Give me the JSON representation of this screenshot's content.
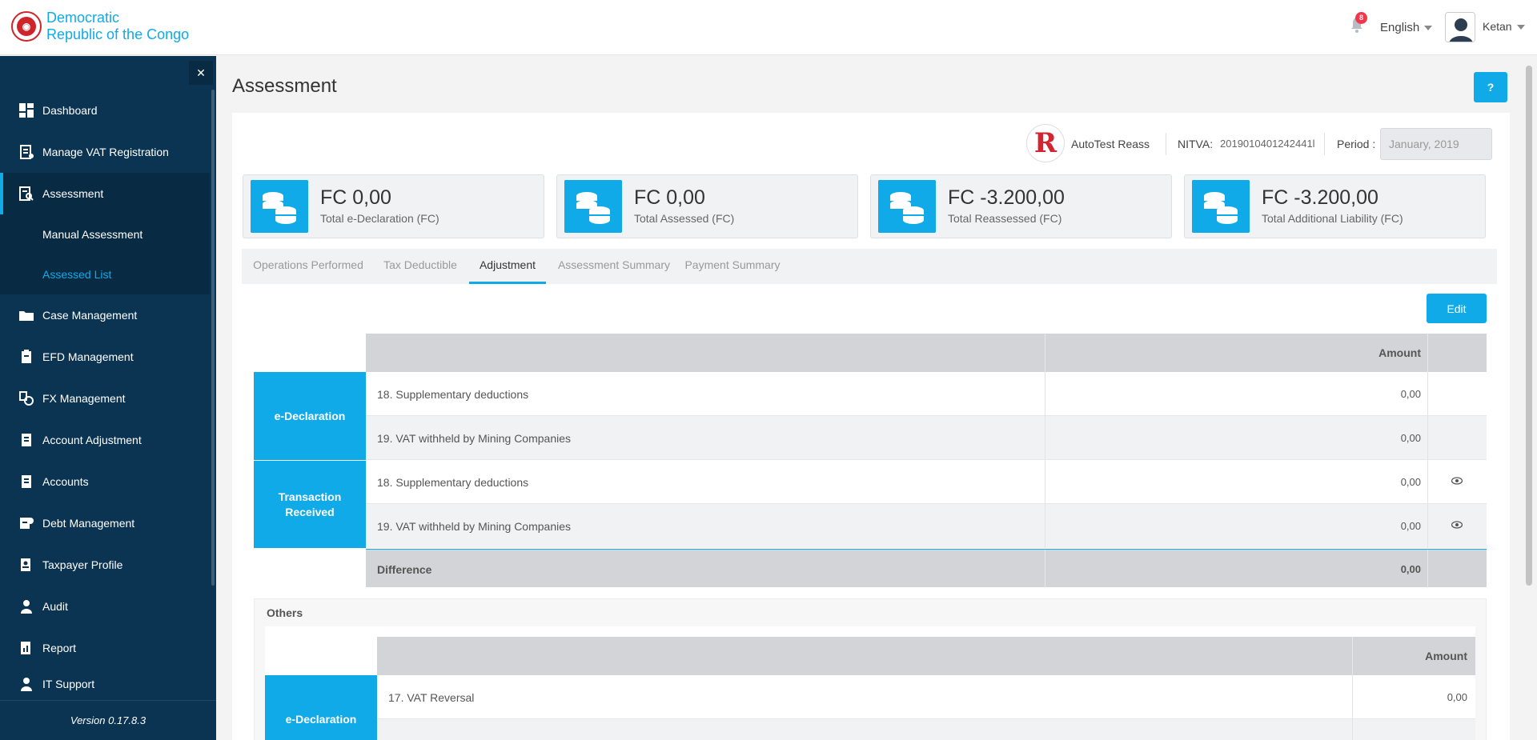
{
  "header": {
    "brand_line1": "Democratic",
    "brand_line2": "Republic of the Congo",
    "notification_count": "8",
    "language": "English",
    "user_name": "Ketan"
  },
  "sidebar": {
    "items": [
      {
        "label": "Dashboard",
        "icon": "dashboard-icon"
      },
      {
        "label": "Manage VAT Registration",
        "icon": "registration-icon"
      },
      {
        "label": "Assessment",
        "icon": "assessment-icon"
      },
      {
        "label": "Case Management",
        "icon": "folder-icon"
      },
      {
        "label": "EFD Management",
        "icon": "device-icon"
      },
      {
        "label": "FX Management",
        "icon": "exchange-icon"
      },
      {
        "label": "Account Adjustment",
        "icon": "document-icon"
      },
      {
        "label": "Accounts",
        "icon": "document-icon"
      },
      {
        "label": "Debt Management",
        "icon": "debt-icon"
      },
      {
        "label": "Taxpayer Profile",
        "icon": "profile-icon"
      },
      {
        "label": "Audit",
        "icon": "user-icon"
      },
      {
        "label": "Report",
        "icon": "report-icon"
      },
      {
        "label": "IT Support",
        "icon": "support-icon"
      }
    ],
    "sub_items": [
      {
        "label": "Manual Assessment"
      },
      {
        "label": "Assessed List"
      }
    ],
    "version": "Version 0.17.8.3"
  },
  "page": {
    "title": "Assessment",
    "help_label": "?"
  },
  "taxpayer": {
    "name": "AutoTest Reass",
    "nitva_label": "NITVA:",
    "nitva_value": "2019010401242441l",
    "period_label": "Period :",
    "period_value": "January, 2019"
  },
  "stats": [
    {
      "value": "FC 0,00",
      "label": "Total e-Declaration (FC)"
    },
    {
      "value": "FC 0,00",
      "label": "Total Assessed (FC)"
    },
    {
      "value": "FC -3.200,00",
      "label": "Total Reassessed (FC)"
    },
    {
      "value": "FC -3.200,00",
      "label": "Total Additional Liability (FC)"
    }
  ],
  "tabs": [
    {
      "label": "Operations Performed"
    },
    {
      "label": "Tax Deductible"
    },
    {
      "label": "Adjustment"
    },
    {
      "label": "Assessment Summary"
    },
    {
      "label": "Payment Summary"
    }
  ],
  "active_tab": "Adjustment",
  "edit_label": "Edit",
  "table": {
    "amount_header": "Amount",
    "groups": [
      {
        "label": "e-Declaration",
        "rows": [
          {
            "desc": "18. Supplementary deductions",
            "amount": "0,00"
          },
          {
            "desc": "19. VAT withheld by Mining Companies",
            "amount": "0,00"
          }
        ]
      },
      {
        "label": "Transaction Received",
        "rows": [
          {
            "desc": "18. Supplementary deductions",
            "amount": "0,00"
          },
          {
            "desc": "19. VAT withheld by Mining Companies",
            "amount": "0,00"
          }
        ]
      }
    ],
    "difference_label": "Difference",
    "difference_amount": "0,00"
  },
  "others": {
    "title": "Others",
    "amount_header": "Amount",
    "group_label": "e-Declaration",
    "rows": [
      {
        "desc": "17. VAT Reversal",
        "amount": "0,00"
      }
    ]
  },
  "colors": {
    "accent": "#10aae8",
    "sidebar": "#0b3452",
    "badge": "#f2364b"
  }
}
